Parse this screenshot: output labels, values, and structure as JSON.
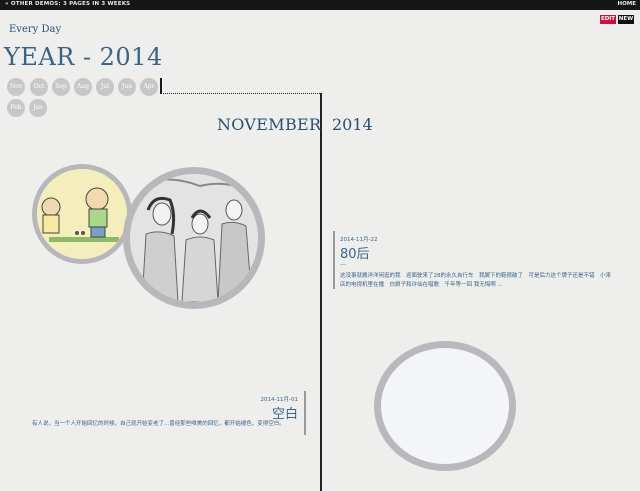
{
  "topbar": {
    "left": "« OTHER DEMOS: 3 PAGES IN 3 WEEKS",
    "right": "HOME"
  },
  "actions": {
    "edit": "EDIT",
    "new": "NEW"
  },
  "header": {
    "subtitle": "Every Day",
    "year_title": "YEAR - 2014"
  },
  "months": [
    "Nov",
    "Oct",
    "Sep",
    "Aug",
    "Jul",
    "Jun",
    "Apr",
    "Feb",
    "Jan"
  ],
  "page": {
    "month": "NOVEMBER",
    "year": "2014"
  },
  "posts": [
    {
      "date": "2014-11月-01",
      "title": "空白",
      "body": "有人说，当一个人开始回忆的时候，自己就开始变老了...曾经那些唯美的回忆，都开始褪色，变得空白。"
    },
    {
      "date": "2014-11月-22",
      "title": "80后",
      "extra": "---",
      "body_line1": "这没事就搬洋洋闲逛的我　迎面驶来了28的永久自行车　我脚下的鞋很破了　可是后力这个牌子还是不错　小来",
      "body_line2": "店的电视机里在播　白娘子和许仙在唱歌　千年等一回 我无悔啊 ..."
    }
  ],
  "colors": {
    "accent": "#3b6388",
    "edit": "#c8143c",
    "month_bubble": "#c7c7c7"
  }
}
